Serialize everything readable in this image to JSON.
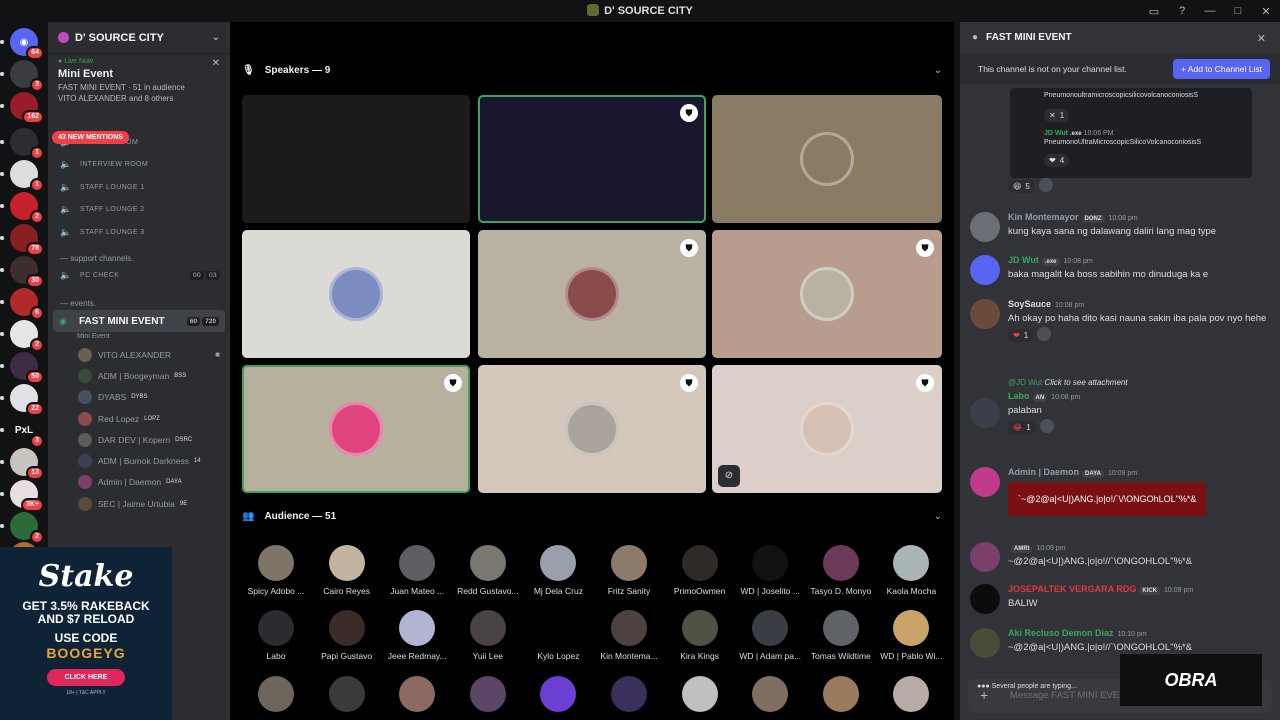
{
  "window": {
    "title": "D' SOURCE CITY"
  },
  "rail": {
    "badges": [
      "64",
      "3",
      "162",
      "1",
      "1",
      "2",
      "78",
      "30",
      "6",
      "2",
      "50",
      "22",
      "3",
      "13",
      "3K+",
      "2"
    ],
    "pxl_label": "PxL"
  },
  "sidebar": {
    "server_name": "D' SOURCE CITY",
    "live": {
      "status": "Live Now",
      "event_name": "Mini Event",
      "meta": "FAST MINI EVENT · 51 in audience",
      "people": "VITO ALEXANDER and 8 others"
    },
    "mentions": "43 NEW MENTIONS",
    "channels": [
      {
        "icon": "speaker",
        "name": "WAITING ROOM"
      },
      {
        "icon": "speaker",
        "name": "INTERVIEW ROOM"
      },
      {
        "icon": "speaker",
        "name": "STAFF LOUNGE 1"
      },
      {
        "icon": "speaker",
        "name": "STAFF LOUNGE 2"
      },
      {
        "icon": "speaker",
        "name": "STAFF LOUNGE 3"
      }
    ],
    "category_support": "— support channels.",
    "pc_check": {
      "name": "PC CHECK",
      "count_a": "00",
      "count_b": "03"
    },
    "category_events": "— events.",
    "selected_channel": {
      "name": "FAST MINI EVENT",
      "sublabel": "Mini Event",
      "video_count": "60",
      "user_count": "720"
    },
    "users": [
      {
        "name": "VITO ALEXANDER",
        "tag": "",
        "color": "#6b5d52"
      },
      {
        "name": "ADM | Boogeyman",
        "tag": "BSS",
        "color": "#3b4a3a"
      },
      {
        "name": "DYABS",
        "tag": "DYBS",
        "color": "#4a4f63"
      },
      {
        "name": "Red Lopez",
        "tag": "LOPZ",
        "color": "#8a4b4b"
      },
      {
        "name": "DAR DEV | Kopern",
        "tag": "DSRC",
        "color": "#5b5b5b"
      },
      {
        "name": "ADM | Burnok Darkness",
        "tag": "14",
        "color": "#3d3f55"
      },
      {
        "name": "Admin | Daemon",
        "tag": "DAYA",
        "color": "#7a3f6a"
      },
      {
        "name": "SEC | Jaime Urtubia",
        "tag": "9E",
        "color": "#5a4b3a"
      }
    ]
  },
  "ad": {
    "brand": "Stake",
    "line1": "GET 3.5% RAKEBACK",
    "line2": "AND $7 RELOAD",
    "line3": "USE CODE",
    "code": "BOOGEYG",
    "button": "CLICK HERE",
    "terms": "18+ | T&C APPLY"
  },
  "stage": {
    "speakers_label": "Speakers — 9",
    "audience_label": "Audience — 51",
    "tiles": [
      {
        "bg": "#1c1b1a",
        "has_shield": false,
        "highlight": false
      },
      {
        "bg": "#1a1630",
        "has_shield": true,
        "highlight": true
      },
      {
        "bg": "#8a7b65",
        "has_shield": false,
        "highlight": false
      },
      {
        "bg": "#dcdad5",
        "has_shield": false,
        "highlight": false
      },
      {
        "bg": "#b9b2a3",
        "has_shield": true,
        "highlight": false
      },
      {
        "bg": "#b89c8e",
        "has_shield": true,
        "highlight": false
      },
      {
        "bg": "#b6b09d",
        "has_shield": true,
        "highlight": true
      },
      {
        "bg": "#d3c8bb",
        "has_shield": true,
        "highlight": false
      },
      {
        "bg": "#dccfca",
        "has_shield": true,
        "highlight": false
      }
    ],
    "audience": [
      {
        "name": "Spicy Adobo ...",
        "color": "#7e7468"
      },
      {
        "name": "Cairo Reyes",
        "color": "#c5b3a2"
      },
      {
        "name": "Juan Mateo ...",
        "color": "#5c5e63"
      },
      {
        "name": "Redd Gustavo...",
        "color": "#7b7771"
      },
      {
        "name": "Mj Dela Cruz",
        "color": "#9aa0ab"
      },
      {
        "name": "Fritz Sanity",
        "color": "#8c7b6b"
      },
      {
        "name": "PrimoOwmen",
        "color": "#2d2a28"
      },
      {
        "name": "WD | Joselito ...",
        "color": "#111111"
      },
      {
        "name": "Tasyo D. Monyo",
        "color": "#6c3958"
      },
      {
        "name": "Kaola Mocha",
        "color": "#a9b4b7"
      },
      {
        "name": "Labo",
        "color": "#2a2c30"
      },
      {
        "name": "Papi Gustavo",
        "color": "#3b2c2a"
      },
      {
        "name": "Jeee Redmay...",
        "color": "#b1b5d2"
      },
      {
        "name": "Yuii Lee",
        "color": "#4a4345"
      },
      {
        "name": "Kylo Lopez",
        "color": "#000000"
      },
      {
        "name": "Kin Montema...",
        "color": "#4e4240"
      },
      {
        "name": "Kira Kings",
        "color": "#4d5244"
      },
      {
        "name": "WD | Adam pa...",
        "color": "#3b3d44"
      },
      {
        "name": "Tomas Wildtime",
        "color": "#606468"
      },
      {
        "name": "WD | Pablo Wi...",
        "color": "#c9a36a"
      }
    ],
    "audience_row3_colors": [
      "#6d655c",
      "#3a3a3a",
      "#8c6a62",
      "#5b4668",
      "#6a3fd2",
      "#3a2f5d",
      "#c0c0c0",
      "#7e6f62",
      "#9b7a5d",
      "#b8aaa5"
    ]
  },
  "chat": {
    "title": "FAST MINI EVENT",
    "notice": "This channel is not on your channel list.",
    "add_button": "Add to Channel List",
    "embed": {
      "line1": "PneumonoultramicroscopicsilicovolcanoconiosisS",
      "reaction1": "1",
      "user": "JD Wut",
      "badge": ".exe",
      "time": "10:06 PM",
      "line2": "PneumonoUltraMicroscopicSilicoVolcanoconiosisS",
      "reaction2": "4"
    },
    "top_reaction": {
      "emoji": "😆",
      "count": "5"
    },
    "messages": [
      {
        "user": "Kin Montemayor",
        "badge": "DONZ",
        "time": "10:08 pm",
        "text": "kung kaya sana ng dalawang daliri lang mag type",
        "color": "#949ba4"
      },
      {
        "user": "JD Wut",
        "badge": ".exe",
        "time": "10:08 pm",
        "text": "baka magalit ka boss sabihin mo dinuduga ka e",
        "color": "#3ba55d"
      },
      {
        "user": "SoySauce",
        "badge": "",
        "time": "10:08 pm",
        "text": "Ah okay po haha dito kasi nauna sakin iba pala pov nyo hehe",
        "color": "#dbdee1",
        "reaction": "❤",
        "count": "1"
      },
      {
        "user": "Labo",
        "badge": "AN",
        "time": "10:08 pm",
        "text": "palaban",
        "color": "#3ba55d",
        "reply": "@JD Wut",
        "reply_hint": "Click to see attachment",
        "reaction": "😂",
        "count": "1"
      },
      {
        "user": "Admin | Daemon",
        "badge": "DAYA",
        "time": "10:09 pm",
        "text": "`~@2@a|<U|)ANG.|o|o!/`\\/\\ONGOhLOL\"%*&",
        "color": "#949ba4"
      },
      {
        "user": "",
        "badge": "AMRI",
        "time": "10:09 pm",
        "text": "~@2@a|<U|)ANG.|o|o!//`\\ONGOHLOL\"%*&",
        "color": "#dbdee1"
      },
      {
        "user": "JOSEPALTEK VERGARA RDG",
        "badge": "KICK",
        "time": "10:09 pm",
        "text": "BALIW",
        "color": "#e03a3a"
      },
      {
        "user": "Aki Recluso Demon Diaz",
        "badge": "",
        "time": "10:10 pm",
        "text": "~@2@a|<U|)ANG.|o|o!//`\\ONGOHLOL\"%*&",
        "color": "#3ba55d"
      }
    ],
    "typing": "Several people are typing...",
    "composer_placeholder": "Message FAST MINI EVENT",
    "watermark": "OBRA"
  }
}
